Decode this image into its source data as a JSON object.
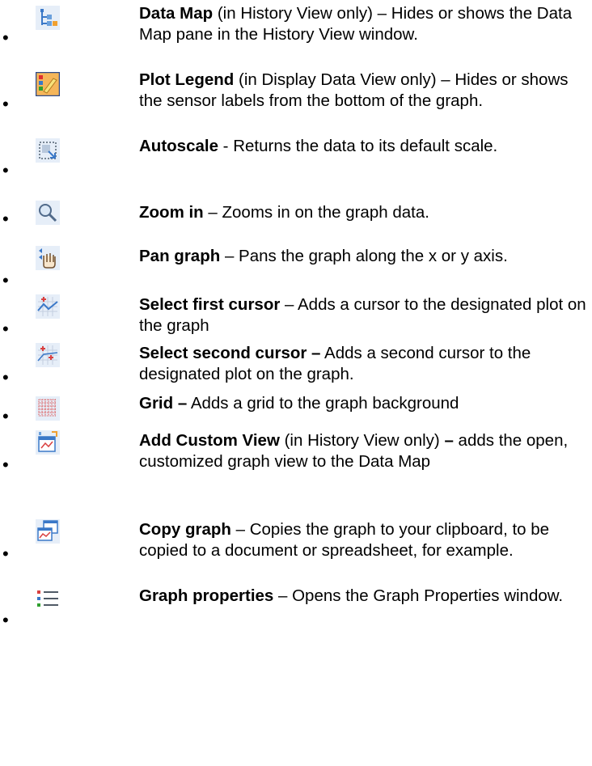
{
  "items": [
    {
      "icon": "data-map-icon",
      "title": "Data Map",
      "rest": " (in History View only) – Hides or shows the Data Map pane in the History View window."
    },
    {
      "icon": "plot-legend-icon",
      "title": "Plot Legend",
      "rest": " (in Display Data View only) – Hides or shows the sensor labels from the bottom of the graph."
    },
    {
      "icon": "autoscale-icon",
      "title": "Autoscale",
      "rest": " - Returns the data to its default scale."
    },
    {
      "icon": "zoom-in-icon",
      "title": "Zoom in",
      "rest": " – Zooms in on the graph data."
    },
    {
      "icon": "pan-graph-icon",
      "title": "Pan graph",
      "rest": " – Pans the graph along the x or y axis."
    },
    {
      "icon": "select-first-cursor-icon",
      "title": "Select first cursor",
      "rest": " – Adds a cursor to the designated plot on the graph"
    },
    {
      "icon": "select-second-cursor-icon",
      "title": "Select second cursor –",
      "rest": " Adds a second cursor to the designated plot on the graph."
    },
    {
      "icon": "grid-icon",
      "title": "Grid –",
      "rest": " Adds a grid to the graph background"
    },
    {
      "icon": "add-custom-view-icon",
      "title": "Add Custom View",
      "rest_a": " (in History View only) ",
      "rest_b_bold": "–",
      "rest_c": " adds the open, customized graph view to the Data Map"
    },
    {
      "icon": "copy-graph-icon",
      "title": "Copy graph",
      "rest": " – Copies the graph to your clipboard, to be copied to a document or spreadsheet, for example."
    },
    {
      "icon": "graph-properties-icon",
      "title": "Graph properties",
      "rest": " – Opens the Graph Properties window."
    }
  ],
  "bullet_char": "•",
  "colors": {
    "icon_bg": "#e6eef8",
    "legend_bg": "#f5b65a",
    "accent_blue": "#3a78c8",
    "grid_red": "#d94040"
  }
}
